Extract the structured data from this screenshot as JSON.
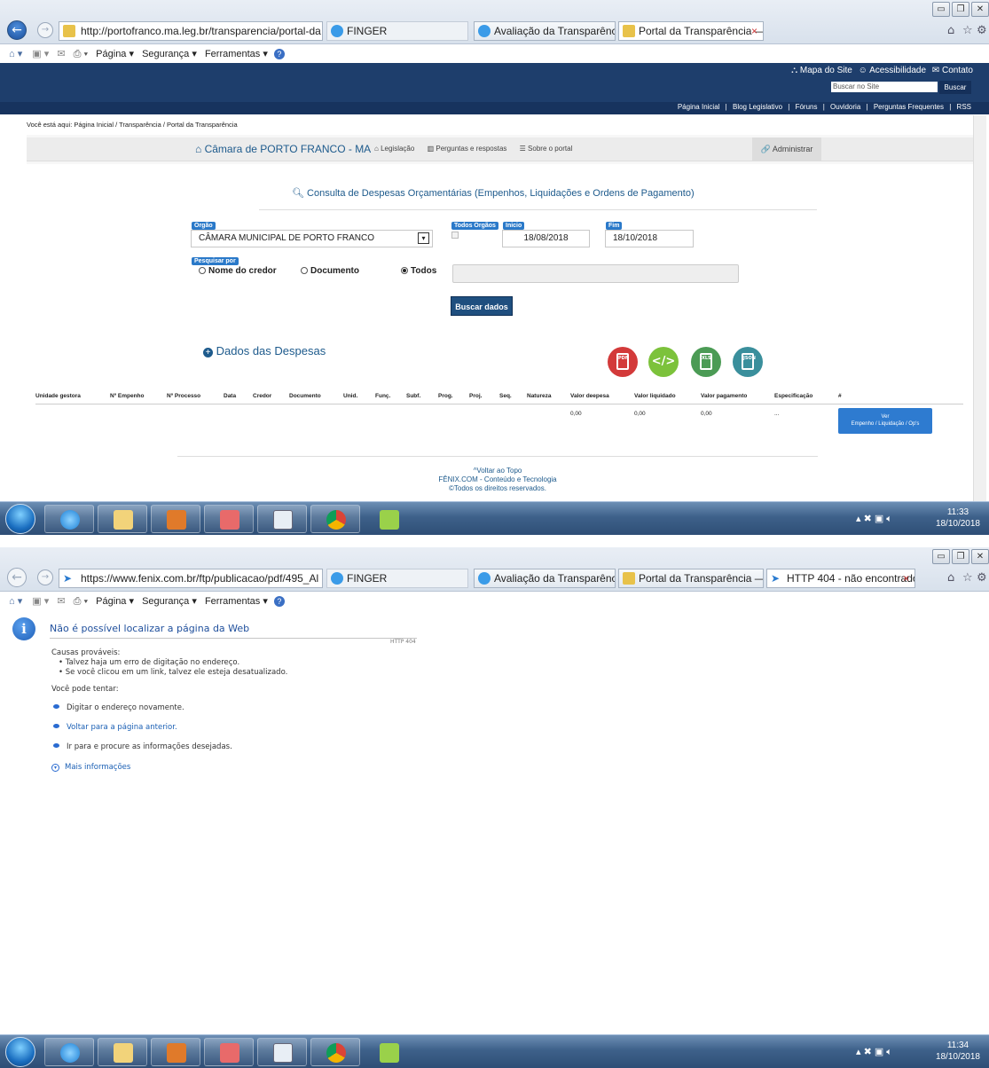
{
  "browser": {
    "find_label": "FINGER",
    "cmd": {
      "page": "Página ▾",
      "security": "Segurança ▾",
      "tools": "Ferramentas ▾"
    }
  },
  "window1": {
    "address": "http://portofranco.ma.leg.br/transparencia/portal-da",
    "tabs": [
      {
        "label": "Avaliação da Transparência do..."
      },
      {
        "label": "Portal da Transparência — ...",
        "close": "×"
      }
    ],
    "site": {
      "top_links": [
        "Mapa do Site",
        "Acessibilidade",
        "Contato"
      ],
      "search_placeholder": "Buscar no Site",
      "search_button": "Buscar",
      "nav": [
        "Página Inicial",
        "|",
        "Blog Legislativo",
        "|",
        "Fóruns",
        "|",
        "Ouvidoria",
        "|",
        "Perguntas Frequentes",
        "|",
        "RSS"
      ],
      "breadcrumb": "Você está aqui: Página Inicial / Transparência / Portal da Transparência"
    },
    "portal": {
      "brand": "Câmara de PORTO FRANCO - MA",
      "menu": [
        "Legislação",
        "Perguntas e respostas",
        "Sobre o portal"
      ],
      "admin": "Administrar",
      "heading": "Consulta de Despesas Orçamentárias (Empenhos, Liquidações e Ordens de Pagamento)",
      "orgao_label": "Orgão",
      "orgao_value": "CÂMARA MUNICIPAL DE PORTO FRANCO",
      "todos_orgaos_label": "Todos Orgãos",
      "inicio_label": "Inicio",
      "inicio_value": "18/08/2018",
      "fim_label": "Fim",
      "fim_value": "18/10/2018",
      "pesquisar_label": "Pesquisar por",
      "radios": [
        "Nome do credor",
        "Documento",
        "Todos"
      ],
      "radio_selected": "Todos",
      "buscar_button": "Buscar dados",
      "dados_title": "Dados das Despesas",
      "export_icons": [
        "pdf-export-icon",
        "xml-export-icon",
        "xls-export-icon",
        "json-export-icon"
      ],
      "export_labels": [
        "PDF",
        "XLS",
        "JSON"
      ],
      "columns": [
        "Unidade gestora",
        "Nº Empenho",
        "Nº Processo",
        "Data",
        "Credor",
        "Documento",
        "Unid.",
        "Funç.",
        "Subf.",
        "Prog.",
        "Proj.",
        "Seq.",
        "Natureza",
        "Valor deepesa",
        "Valor liquidado",
        "Valor pagamento",
        "Especificação",
        "#"
      ],
      "row": {
        "valor_despesa": "0,00",
        "valor_liquidado": "0,00",
        "valor_pagamento": "0,00",
        "especificacao": "...",
        "action_line1": "Ver",
        "action_line2": "Empenho / Liquidação / Op's"
      },
      "footer": [
        "Voltar ao Topo",
        "FÊNIX.COM - Conteúdo e Tecnologia",
        "©Todos os direitos reservados."
      ]
    },
    "clock": {
      "time": "11:33",
      "date": "18/10/2018"
    }
  },
  "window2": {
    "address": "https://www.fenix.com.br/ftp/publicacao/pdf/495_Al",
    "tabs": [
      {
        "label": "Avaliação da Transparência do..."
      },
      {
        "label": "Portal da Transparência — Por..."
      },
      {
        "label": "HTTP 404 - não encontrado",
        "close": "×"
      }
    ],
    "error": {
      "title": "Não é possível localizar a página da Web",
      "code": "HTTP 404",
      "causes_title": "Causas prováveis:",
      "causes": [
        "• Talvez haja um erro de digitação no endereço.",
        "• Se você clicou em um link, talvez ele esteja desatualizado."
      ],
      "try_title": "Você pode tentar:",
      "try": [
        "Digitar o endereço novamente.",
        "Voltar para a página anterior.",
        "Ir para  e procure as informações desejadas."
      ],
      "more": "Mais informações"
    },
    "clock": {
      "time": "11:34",
      "date": "18/10/2018"
    }
  }
}
